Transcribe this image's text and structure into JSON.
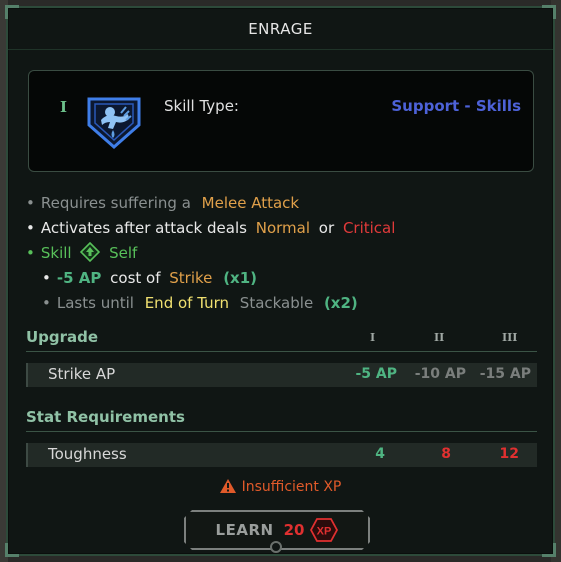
{
  "title": "ENRAGE",
  "rank_glyph": "I",
  "skill_type": {
    "label": "Skill Type:",
    "value": "Support - Skills"
  },
  "effects": {
    "line1": {
      "pre": "Requires suffering a",
      "highlight": "Melee Attack"
    },
    "line2": {
      "pre": "Activates after attack deals",
      "normal": "Normal",
      "or": "or",
      "critical": "Critical"
    },
    "line3": {
      "skill": "Skill",
      "target": "Self"
    },
    "line4": {
      "amount": "-5 AP",
      "mid": "cost of",
      "ability": "Strike",
      "mult": "(x1)"
    },
    "line5": {
      "pre": "Lasts until",
      "duration": "End of Turn",
      "stack": "Stackable",
      "mult": "(x2)"
    }
  },
  "upgrade": {
    "heading": "Upgrade",
    "levels": [
      "I",
      "II",
      "III"
    ],
    "rows": [
      {
        "name": "Strike AP",
        "values": [
          "-5 AP",
          "-10 AP",
          "-15 AP"
        ]
      }
    ]
  },
  "requirements": {
    "heading": "Stat Requirements",
    "rows": [
      {
        "name": "Toughness",
        "values": [
          "4",
          "8",
          "12"
        ]
      }
    ]
  },
  "warning": "Insufficient XP",
  "learn": {
    "label": "LEARN",
    "cost": "20",
    "currency": "XP"
  },
  "colors": {
    "accent_teal": "#4fb482",
    "skill_blue": "#4d62d8",
    "warning_red": "#e03a3a",
    "highlight_orange": "#e0a04a"
  },
  "icons": [
    "enrage-skill-icon",
    "self-target-icon",
    "warning-icon",
    "xp-icon"
  ]
}
